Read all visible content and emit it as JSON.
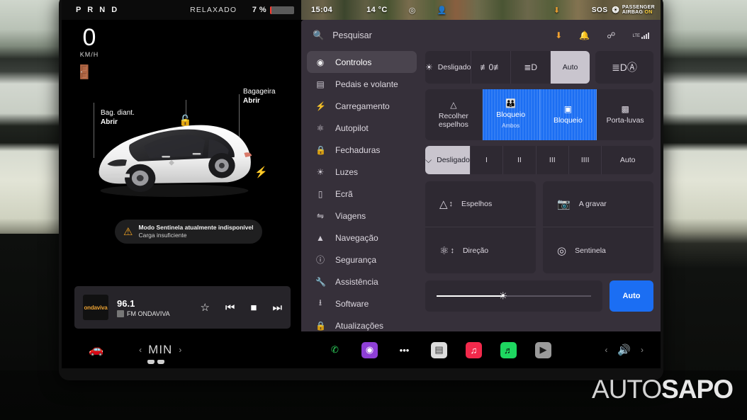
{
  "status_bar": {
    "gear": "P R N D",
    "drive_mode": "RELAXADO",
    "battery_percent": "7 %",
    "clock": "15:04",
    "temperature": "14 °C",
    "sos_label": "SOS",
    "airbag_label_line1": "PASSENGER",
    "airbag_label_line2": "AIRBAG",
    "airbag_state": "ON",
    "icons": [
      "sentry-icon",
      "occupant-icon",
      "download-icon"
    ]
  },
  "driving": {
    "speed_value": "0",
    "speed_unit": "KM/H",
    "seatbelt_icon": "seatbelt-warning-icon",
    "callout_front": {
      "title": "Bag. diant.",
      "action": "Abrir"
    },
    "callout_rear": {
      "title": "Bagageira",
      "action": "Abrir"
    },
    "lock_icon": "unlocked-padlock-icon",
    "charge_icon": "charge-bolt-icon",
    "sentry_banner": {
      "title": "Modo Sentinela atualmente indisponível",
      "subtitle": "Carga insuficiente"
    }
  },
  "media": {
    "album_art_label": "ondaviva",
    "frequency": "96.1",
    "station": "FM ONDAVIVA",
    "controls": [
      "favorite-star-icon",
      "previous-track-icon",
      "stop-icon",
      "next-track-icon"
    ]
  },
  "dock": {
    "car_icon": "car-icon",
    "temp_prev": "‹",
    "temp_value": "MIN",
    "temp_next": "›",
    "apps": [
      {
        "name": "phone-app-icon",
        "glyph": "✆",
        "bg": "transparent",
        "color": "#2fd45e"
      },
      {
        "name": "siri-app-icon",
        "glyph": "◉",
        "bg": "#8e3fd6",
        "color": "#ffffff"
      },
      {
        "name": "more-apps-icon",
        "glyph": "•••",
        "bg": "transparent",
        "color": "#ffffff"
      },
      {
        "name": "news-app-icon",
        "glyph": "▤",
        "bg": "#dcdcdc",
        "color": "#333333"
      },
      {
        "name": "music-app-icon",
        "glyph": "♫",
        "bg": "#f2294b",
        "color": "#ffffff"
      },
      {
        "name": "spotify-app-icon",
        "glyph": "♬",
        "bg": "#1ed760",
        "color": "#0b0b0b"
      },
      {
        "name": "video-app-icon",
        "glyph": "▶",
        "bg": "#9a9a9a",
        "color": "#1a1a1a"
      }
    ],
    "volume_prev": "‹",
    "volume_icon": "speaker-volume-icon",
    "volume_next": "›"
  },
  "controls_panel": {
    "search": {
      "icon": "search-icon",
      "placeholder": "Pesquisar"
    },
    "status_icons": [
      "download-icon",
      "bell-icon",
      "bluetooth-icon",
      "lte-signal-icon"
    ],
    "lte_label": "LTE",
    "nav_items": [
      {
        "icon": "toggle-icon",
        "label": "Controlos",
        "active": true
      },
      {
        "icon": "pedals-icon",
        "label": "Pedais e volante",
        "active": false
      },
      {
        "icon": "bolt-icon",
        "label": "Carregamento",
        "active": false
      },
      {
        "icon": "steering-icon",
        "label": "Autopilot",
        "active": false
      },
      {
        "icon": "lock-icon",
        "label": "Fechaduras",
        "active": false
      },
      {
        "icon": "light-icon",
        "label": "Luzes",
        "active": false
      },
      {
        "icon": "display-icon",
        "label": "Ecrã",
        "active": false
      },
      {
        "icon": "trips-icon",
        "label": "Viagens",
        "active": false
      },
      {
        "icon": "navigation-icon",
        "label": "Navegação",
        "active": false
      },
      {
        "icon": "safety-icon",
        "label": "Segurança",
        "active": false
      },
      {
        "icon": "wrench-icon",
        "label": "Assistência",
        "active": false
      },
      {
        "icon": "download-icon",
        "label": "Software",
        "active": false
      },
      {
        "icon": "upgrades-icon",
        "label": "Atualizações",
        "active": false
      }
    ],
    "lights_row": [
      {
        "icon": "light-off-icon",
        "label": "Desligado",
        "selected": false
      },
      {
        "icon": "parking-lights-icon",
        "label": "",
        "selected": false
      },
      {
        "icon": "low-beam-icon",
        "label": "",
        "selected": false
      },
      {
        "icon": "",
        "label": "Auto",
        "selected": true
      }
    ],
    "high_beam": {
      "icon": "auto-high-beam-icon",
      "label": ""
    },
    "locks_row": [
      {
        "icon": "mirror-fold-icon",
        "label": "Recolher\nespelhos",
        "sub": "",
        "active": false
      },
      {
        "icon": "child-lock-icon",
        "label": "Bloqueio",
        "sub": "Ambos",
        "active": true
      },
      {
        "icon": "window-lock-icon",
        "label": "Bloqueio",
        "sub": "",
        "active": true
      },
      {
        "icon": "glovebox-icon",
        "label": "Porta-luvas",
        "sub": "",
        "active": false
      }
    ],
    "wipers_row": [
      {
        "icon": "wiper-icon",
        "label": "Desligado",
        "selected": true
      },
      {
        "icon": "",
        "label": "I",
        "selected": false
      },
      {
        "icon": "",
        "label": "II",
        "selected": false
      },
      {
        "icon": "",
        "label": "III",
        "selected": false
      },
      {
        "icon": "",
        "label": "IIII",
        "selected": false
      },
      {
        "icon": "",
        "label": "Auto",
        "selected": false
      }
    ],
    "tiles_left": [
      {
        "icon": "mirror-adjust-icon",
        "label": "Espelhos"
      },
      {
        "icon": "steering-adjust-icon",
        "label": "Direção"
      }
    ],
    "tiles_right": [
      {
        "icon": "dashcam-record-icon",
        "label": "A gravar"
      },
      {
        "icon": "sentry-mode-icon",
        "label": "Sentinela"
      }
    ],
    "brightness": {
      "icon": "brightness-icon",
      "value_percent": "43"
    },
    "auto_brightness": {
      "label": "Auto"
    }
  },
  "watermark": {
    "part1": "AUTO",
    "part2": "SAPO"
  },
  "colors": {
    "panel_bg": "#36303a",
    "accent_blue": "#1b6ef3",
    "selected_light": "#c9c5ce",
    "warning_amber": "#f5a623",
    "battery_red": "#ff3b30"
  }
}
